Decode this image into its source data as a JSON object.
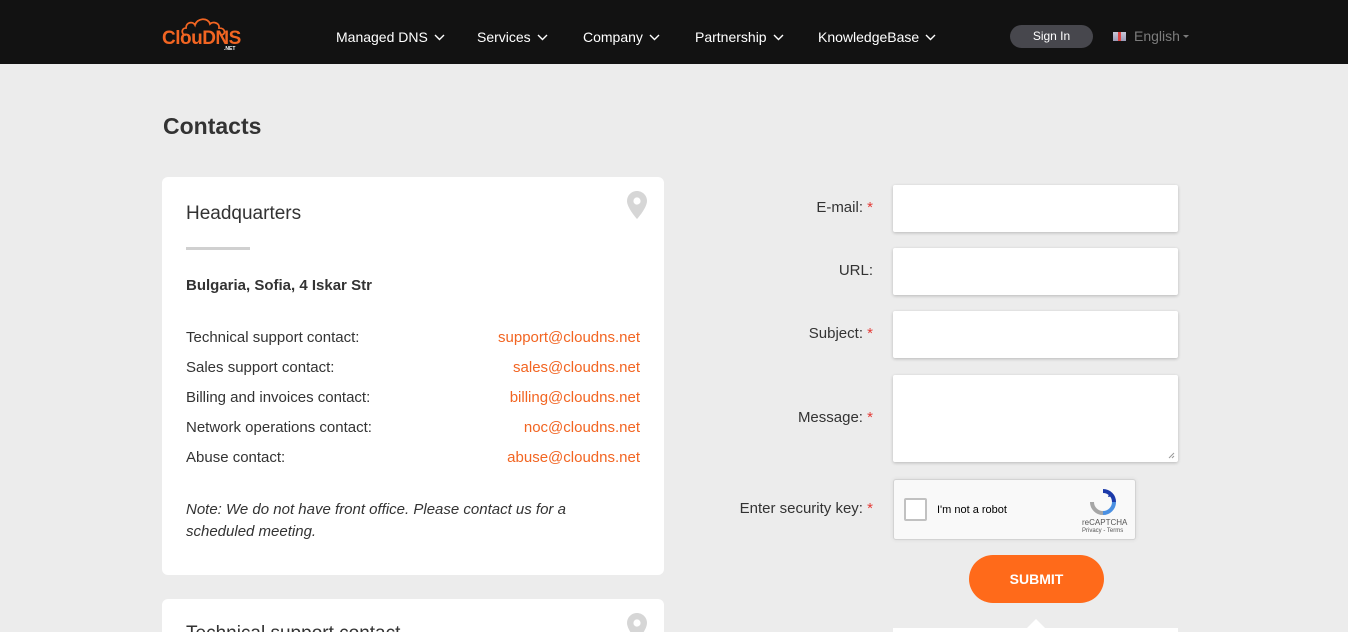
{
  "brand": {
    "logo_text": "ClouDNS",
    "logo_suffix": ".NET",
    "accent": "#f26522"
  },
  "nav": {
    "items": [
      {
        "label": "Managed DNS"
      },
      {
        "label": "Services"
      },
      {
        "label": "Company"
      },
      {
        "label": "Partnership"
      },
      {
        "label": "KnowledgeBase"
      }
    ],
    "signin_label": "Sign In",
    "language_label": "English"
  },
  "page": {
    "title": "Contacts"
  },
  "headquarters": {
    "title": "Headquarters",
    "address": "Bulgaria, Sofia, 4 Iskar Str",
    "contacts": [
      {
        "label": "Technical support contact:",
        "email": "support@cloudns.net"
      },
      {
        "label": "Sales support contact:",
        "email": "sales@cloudns.net"
      },
      {
        "label": "Billing and invoices contact:",
        "email": "billing@cloudns.net"
      },
      {
        "label": "Network operations contact:",
        "email": "noc@cloudns.net"
      },
      {
        "label": "Abuse contact:",
        "email": "abuse@cloudns.net"
      }
    ],
    "note": "Note: We do not have front office. Please contact us for a scheduled meeting."
  },
  "next_card": {
    "title": "Technical support contact"
  },
  "form": {
    "email_label": "E-mail:",
    "url_label": "URL:",
    "subject_label": "Subject:",
    "message_label": "Message:",
    "security_label": "Enter security key:",
    "required_mark": "*",
    "email_value": "",
    "url_value": "",
    "subject_value": "",
    "message_value": "",
    "submit_label": "SUBMIT"
  },
  "recaptcha": {
    "checkbox_label": "I'm not a robot",
    "brand": "reCAPTCHA",
    "links": "Privacy - Terms"
  }
}
